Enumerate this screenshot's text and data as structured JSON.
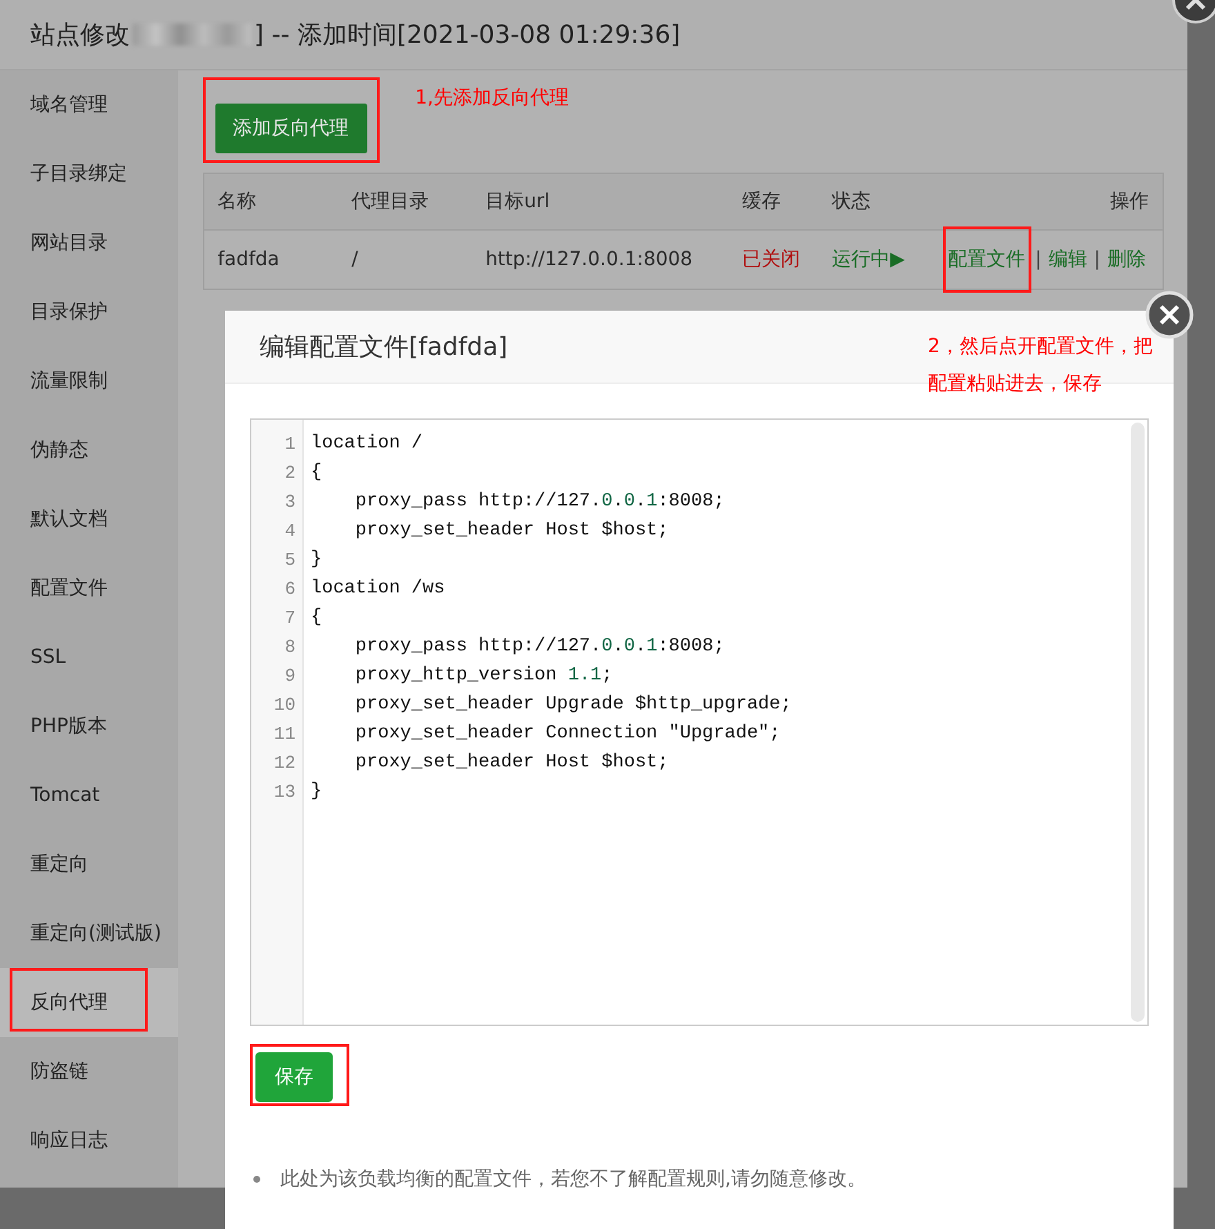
{
  "window": {
    "title_prefix": "站点修改",
    "title_suffix": "] -- 添加时间[2021-03-08 01:29:36]"
  },
  "sidebar": {
    "items": [
      {
        "label": "域名管理",
        "selected": false,
        "highlighted": false
      },
      {
        "label": "子目录绑定",
        "selected": false,
        "highlighted": false
      },
      {
        "label": "网站目录",
        "selected": false,
        "highlighted": false
      },
      {
        "label": "目录保护",
        "selected": false,
        "highlighted": false
      },
      {
        "label": "流量限制",
        "selected": false,
        "highlighted": false
      },
      {
        "label": "伪静态",
        "selected": false,
        "highlighted": false
      },
      {
        "label": "默认文档",
        "selected": false,
        "highlighted": false
      },
      {
        "label": "配置文件",
        "selected": false,
        "highlighted": false
      },
      {
        "label": "SSL",
        "selected": false,
        "highlighted": false
      },
      {
        "label": "PHP版本",
        "selected": false,
        "highlighted": false
      },
      {
        "label": "Tomcat",
        "selected": false,
        "highlighted": false
      },
      {
        "label": "重定向",
        "selected": false,
        "highlighted": false
      },
      {
        "label": "重定向(测试版)",
        "selected": false,
        "highlighted": false
      },
      {
        "label": "反向代理",
        "selected": true,
        "highlighted": true
      },
      {
        "label": "防盗链",
        "selected": false,
        "highlighted": false
      },
      {
        "label": "响应日志",
        "selected": false,
        "highlighted": false
      }
    ]
  },
  "add_button": {
    "label": "添加反向代理",
    "highlighted": true
  },
  "note_1": "1,先添加反向代理",
  "table": {
    "columns": [
      "名称",
      "代理目录",
      "目标url",
      "缓存",
      "状态",
      "操作"
    ],
    "rows": [
      {
        "name": "fadfda",
        "directory": "/",
        "target": "http://127.0.0.1:8008",
        "cache": {
          "text": "已关闭",
          "on": false
        },
        "status": {
          "text": "运行中▶",
          "running": true
        },
        "actions": [
          {
            "label": "配置文件",
            "highlighted": true
          },
          {
            "label": "编辑",
            "highlighted": false
          },
          {
            "label": "删除",
            "highlighted": false
          }
        ],
        "separator": "|"
      }
    ]
  },
  "modal": {
    "title": "编辑配置文件[fadfda]",
    "note_2": "2，然后点开配置文件，把配置粘贴进去，保存",
    "code": [
      {
        "number": "1",
        "parts": [
          {
            "text": "location /",
            "kind": "plain"
          }
        ]
      },
      {
        "number": "2",
        "parts": [
          {
            "text": "{",
            "kind": "plain"
          }
        ]
      },
      {
        "number": "3",
        "parts": [
          {
            "text": "    proxy_pass http://127.",
            "kind": "plain"
          },
          {
            "text": "0",
            "kind": "number"
          },
          {
            "text": ".",
            "kind": "plain"
          },
          {
            "text": "0",
            "kind": "number"
          },
          {
            "text": ".",
            "kind": "plain"
          },
          {
            "text": "1",
            "kind": "number"
          },
          {
            "text": ":8008;",
            "kind": "plain"
          }
        ]
      },
      {
        "number": "4",
        "parts": [
          {
            "text": "    proxy_set_header Host $host;",
            "kind": "plain"
          }
        ]
      },
      {
        "number": "5",
        "parts": [
          {
            "text": "}",
            "kind": "plain"
          }
        ]
      },
      {
        "number": "6",
        "parts": [
          {
            "text": "location /ws",
            "kind": "plain"
          }
        ]
      },
      {
        "number": "7",
        "parts": [
          {
            "text": "{",
            "kind": "plain"
          }
        ]
      },
      {
        "number": "8",
        "parts": [
          {
            "text": "    proxy_pass http://127.",
            "kind": "plain"
          },
          {
            "text": "0",
            "kind": "number"
          },
          {
            "text": ".",
            "kind": "plain"
          },
          {
            "text": "0",
            "kind": "number"
          },
          {
            "text": ".",
            "kind": "plain"
          },
          {
            "text": "1",
            "kind": "number"
          },
          {
            "text": ":8008;",
            "kind": "plain"
          }
        ]
      },
      {
        "number": "9",
        "parts": [
          {
            "text": "    proxy_http_version ",
            "kind": "plain"
          },
          {
            "text": "1.1",
            "kind": "number"
          },
          {
            "text": ";",
            "kind": "plain"
          }
        ]
      },
      {
        "number": "10",
        "parts": [
          {
            "text": "    proxy_set_header Upgrade $http_upgrade;",
            "kind": "plain"
          }
        ]
      },
      {
        "number": "11",
        "parts": [
          {
            "text": "    proxy_set_header Connection \"Upgrade\";",
            "kind": "plain"
          }
        ]
      },
      {
        "number": "12",
        "parts": [
          {
            "text": "    proxy_set_header Host $host;",
            "kind": "plain"
          }
        ]
      },
      {
        "number": "13",
        "parts": [
          {
            "text": "}",
            "kind": "plain"
          }
        ]
      }
    ],
    "save_button": {
      "label": "保存",
      "highlighted": true
    },
    "tip": "此处为该负载均衡的配置文件，若您不了解配置规则,请勿随意修改。"
  }
}
